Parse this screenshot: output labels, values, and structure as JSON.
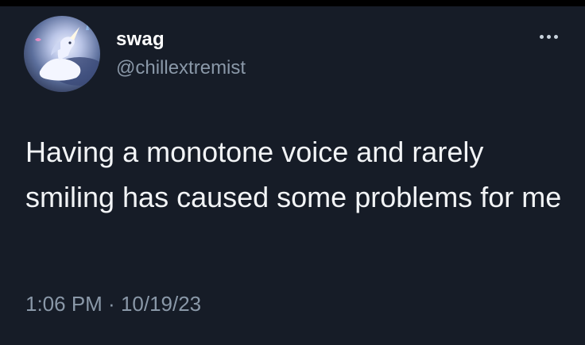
{
  "tweet": {
    "display_name": "swag",
    "handle": "@chillextremist",
    "text": "Having a monotone voice and rarely smiling has caused some problems for me",
    "time": "1:06 PM",
    "separator": " · ",
    "date": "10/19/23"
  },
  "icons": {
    "more": "more-horizontal-icon",
    "avatar": "unicorn-avatar-image"
  },
  "colors": {
    "background": "#161c27",
    "text": "#f2f4f6",
    "secondary": "#8a98a8"
  }
}
